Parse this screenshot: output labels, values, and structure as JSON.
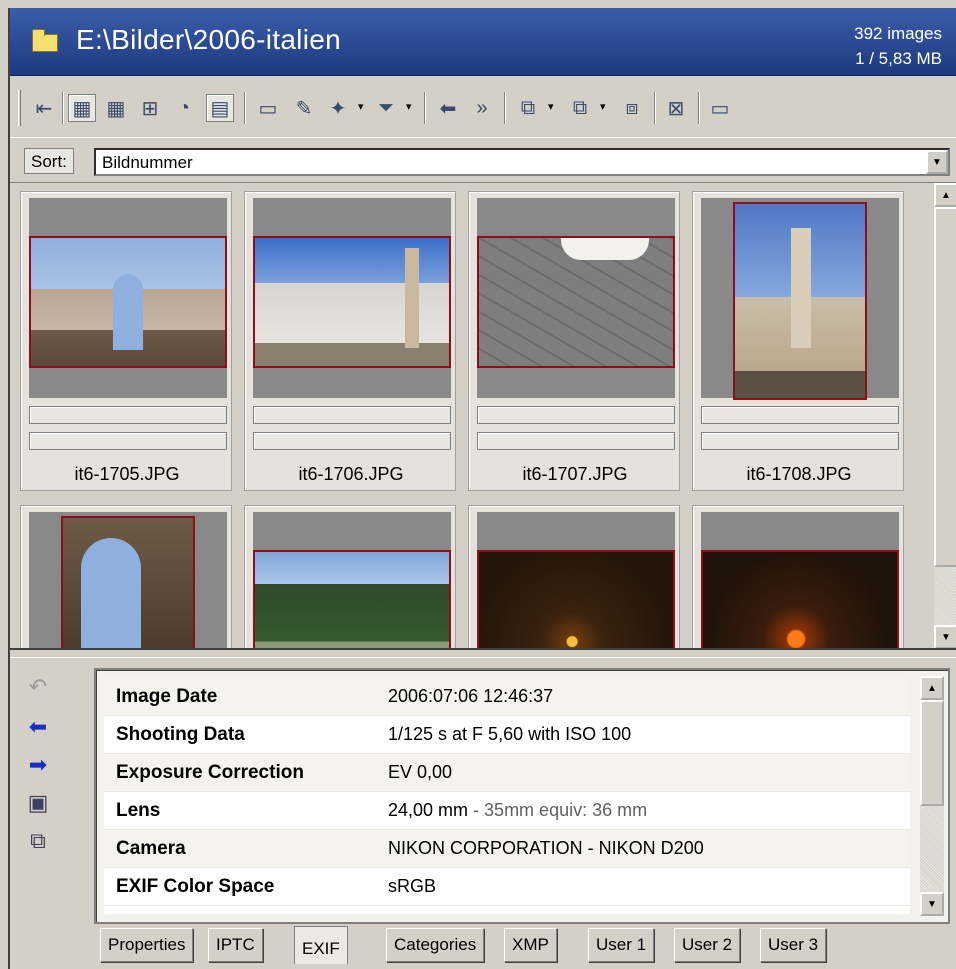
{
  "window": {
    "title": "E:\\Bilder\\2006-italien",
    "image_count": "392 images",
    "size_info": "1 / 5,83 MB"
  },
  "toolbar": {
    "icons": [
      "nav-back-icon",
      "grid-large-icon",
      "grid-medium-icon",
      "grid-small-icon",
      "slideshow-icon",
      "grid-frame-icon",
      "folder-icon",
      "edit-icon",
      "color-icon",
      "filter-icon",
      "rotate-left-icon",
      "rotate-right-icon",
      "copy-icon",
      "move-icon",
      "compare-icon",
      "delete-icon",
      "panel-icon"
    ],
    "active": [
      "grid-large-icon",
      "grid-frame-icon"
    ]
  },
  "sort": {
    "label": "Sort:",
    "value": "Bildnummer"
  },
  "thumbnails": [
    {
      "name": "it6-1705.JPG"
    },
    {
      "name": "it6-1706.JPG"
    },
    {
      "name": "it6-1707.JPG"
    },
    {
      "name": "it6-1708.JPG"
    },
    {
      "name": ""
    },
    {
      "name": ""
    },
    {
      "name": ""
    },
    {
      "name": ""
    }
  ],
  "info": {
    "rows": [
      {
        "key": "Image Date",
        "value": "2006:07:06 12:46:37",
        "extra": ""
      },
      {
        "key": "Shooting Data",
        "value": "1/125 s at F 5,60 with ISO 100",
        "extra": ""
      },
      {
        "key": "Exposure Correction",
        "value": "EV 0,00",
        "extra": ""
      },
      {
        "key": "Lens",
        "value": "24,00 mm",
        "extra": " - 35mm equiv: 36 mm"
      },
      {
        "key": "Camera",
        "value": "NIKON CORPORATION - NIKON D200",
        "extra": ""
      },
      {
        "key": "EXIF Color Space",
        "value": "sRGB",
        "extra": ""
      }
    ]
  },
  "tabs": [
    {
      "label": "Properties"
    },
    {
      "label": "IPTC"
    },
    {
      "label": "EXIF"
    },
    {
      "label": "Categories"
    },
    {
      "label": "XMP"
    },
    {
      "label": "User 1"
    },
    {
      "label": "User 2"
    },
    {
      "label": "User 3"
    }
  ],
  "active_tab": "EXIF"
}
